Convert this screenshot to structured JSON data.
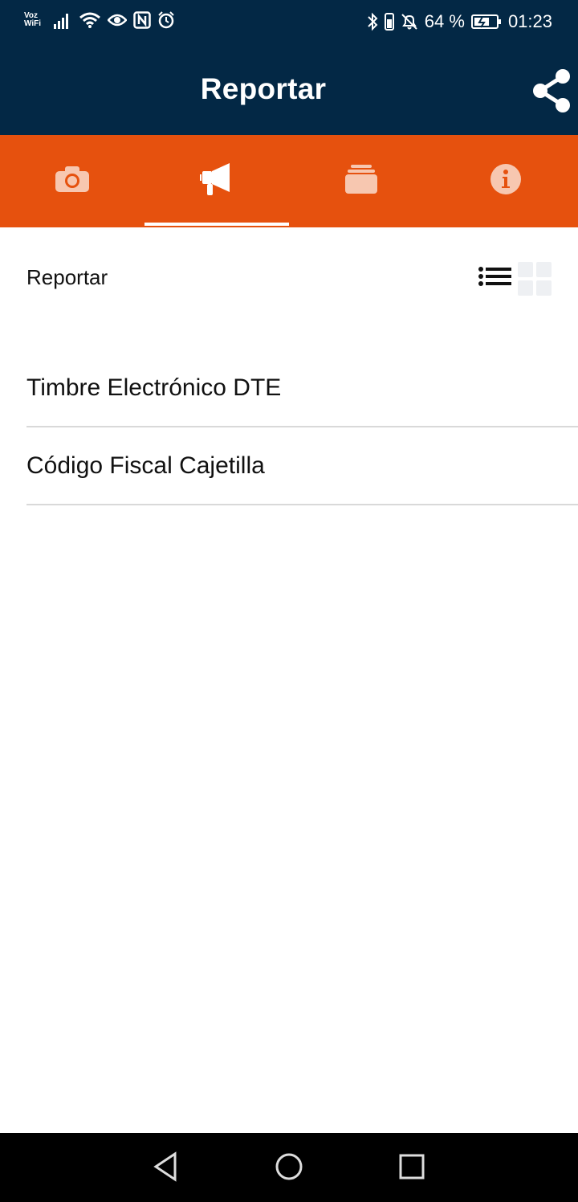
{
  "status_bar": {
    "carrier_label_top": "Voz",
    "carrier_label_bottom": "WiFi",
    "battery_percent": "64 %",
    "time": "01:23",
    "left_icons": [
      "signal-icon",
      "wifi-icon",
      "eye-icon",
      "nfc-icon",
      "alarm-icon"
    ],
    "right_icons": [
      "bluetooth-icon",
      "vibrate-icon",
      "mute-icon",
      "battery-icon"
    ]
  },
  "app_bar": {
    "title": "Reportar",
    "action_icon": "share-icon"
  },
  "tabs": [
    {
      "icon": "camera-icon",
      "active": false
    },
    {
      "icon": "megaphone-icon",
      "active": true
    },
    {
      "icon": "layers-icon",
      "active": false
    },
    {
      "icon": "info-icon",
      "active": false
    }
  ],
  "content": {
    "section_title": "Reportar",
    "view_toggle": {
      "list_icon": "list-view-icon",
      "grid_icon": "grid-view-icon",
      "selected": "list"
    },
    "items": [
      {
        "label": "Timbre Electrónico DTE"
      },
      {
        "label": "Código Fiscal Cajetilla"
      }
    ]
  },
  "nav_bar": {
    "buttons": [
      "back-icon",
      "home-icon",
      "recents-icon"
    ]
  },
  "colors": {
    "header_bg": "#032845",
    "tab_bar_bg": "#e6510e",
    "tab_icon_inactive": "#f7c7b0",
    "tab_indicator": "#ffffff",
    "divider": "#d9d9d9"
  }
}
